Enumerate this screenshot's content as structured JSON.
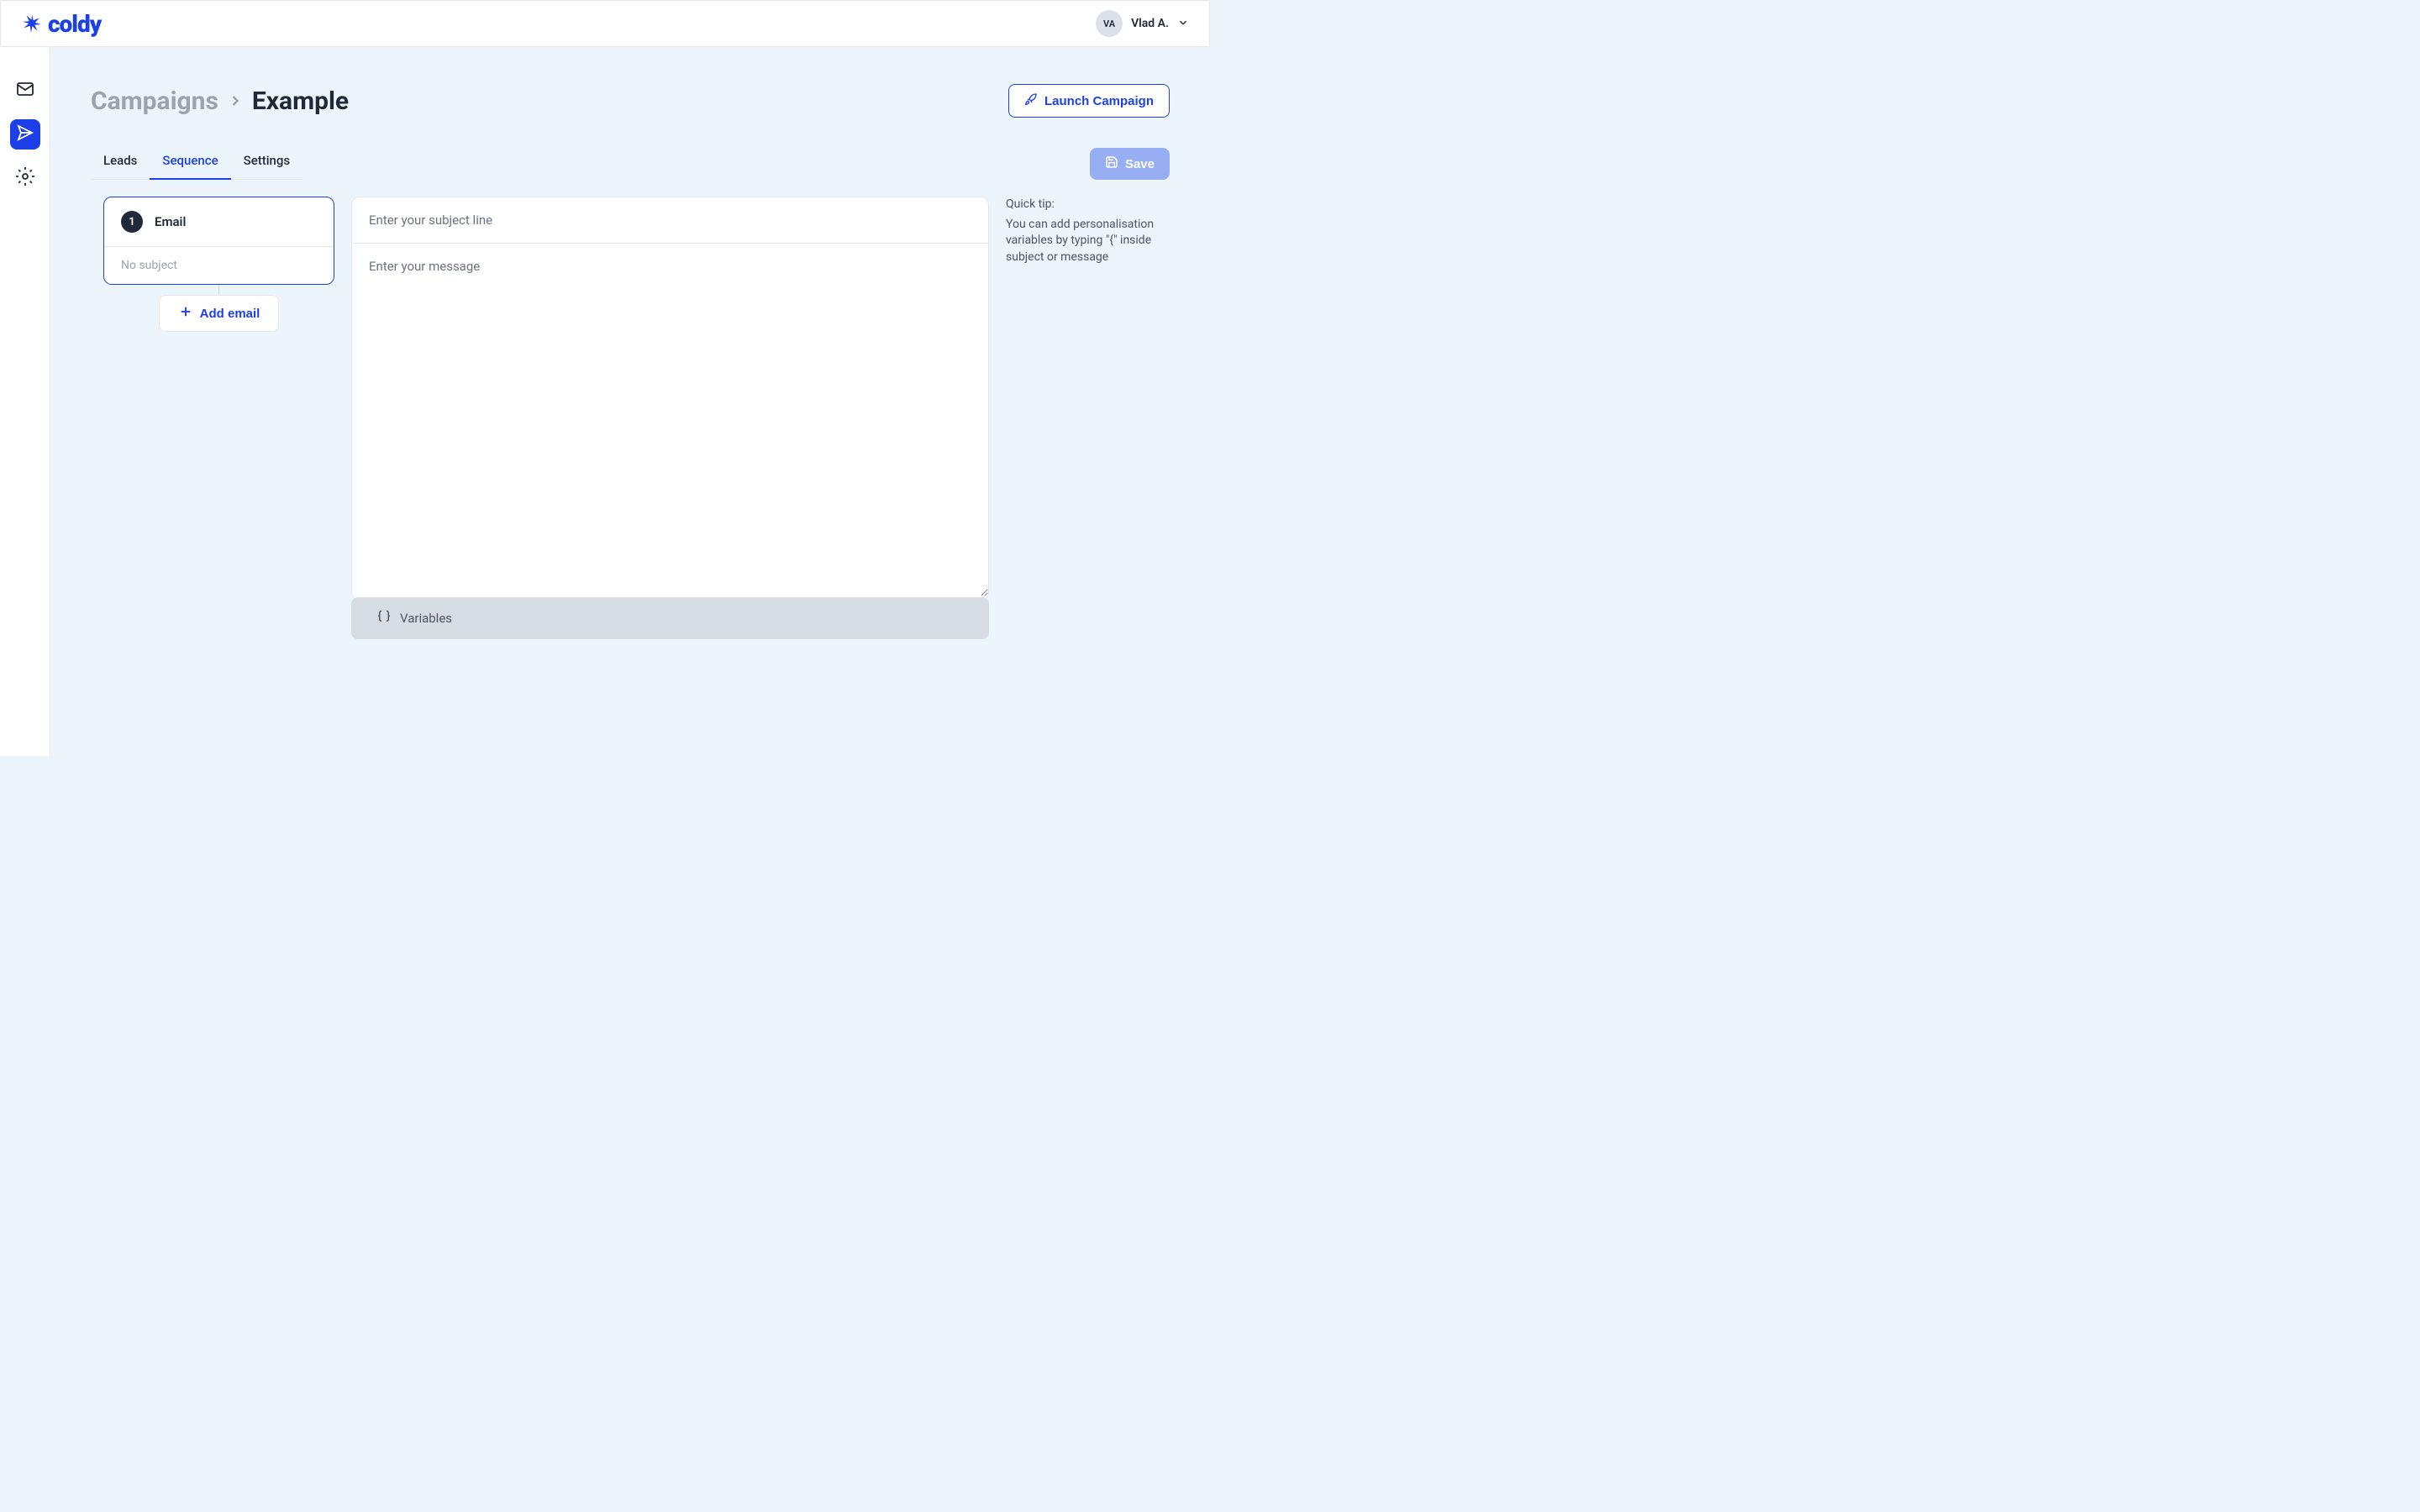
{
  "header": {
    "brand_name": "coldy",
    "user": {
      "initials": "VA",
      "name": "Vlad A."
    }
  },
  "breadcrumb": {
    "parent": "Campaigns",
    "current": "Example"
  },
  "actions": {
    "launch_label": "Launch Campaign",
    "save_label": "Save"
  },
  "tabs": [
    {
      "label": "Leads",
      "active": false
    },
    {
      "label": "Sequence",
      "active": true
    },
    {
      "label": "Settings",
      "active": false
    }
  ],
  "sequence": {
    "step": {
      "number": "1",
      "title": "Email",
      "subject_display": "No subject"
    },
    "add_email_label": "Add email"
  },
  "editor": {
    "subject_placeholder": "Enter your subject line",
    "message_placeholder": "Enter your message",
    "variables_label": "Variables"
  },
  "tip": {
    "title": "Quick tip:",
    "body": "You can add personalisation variables by typing \"{\" inside subject or message"
  }
}
